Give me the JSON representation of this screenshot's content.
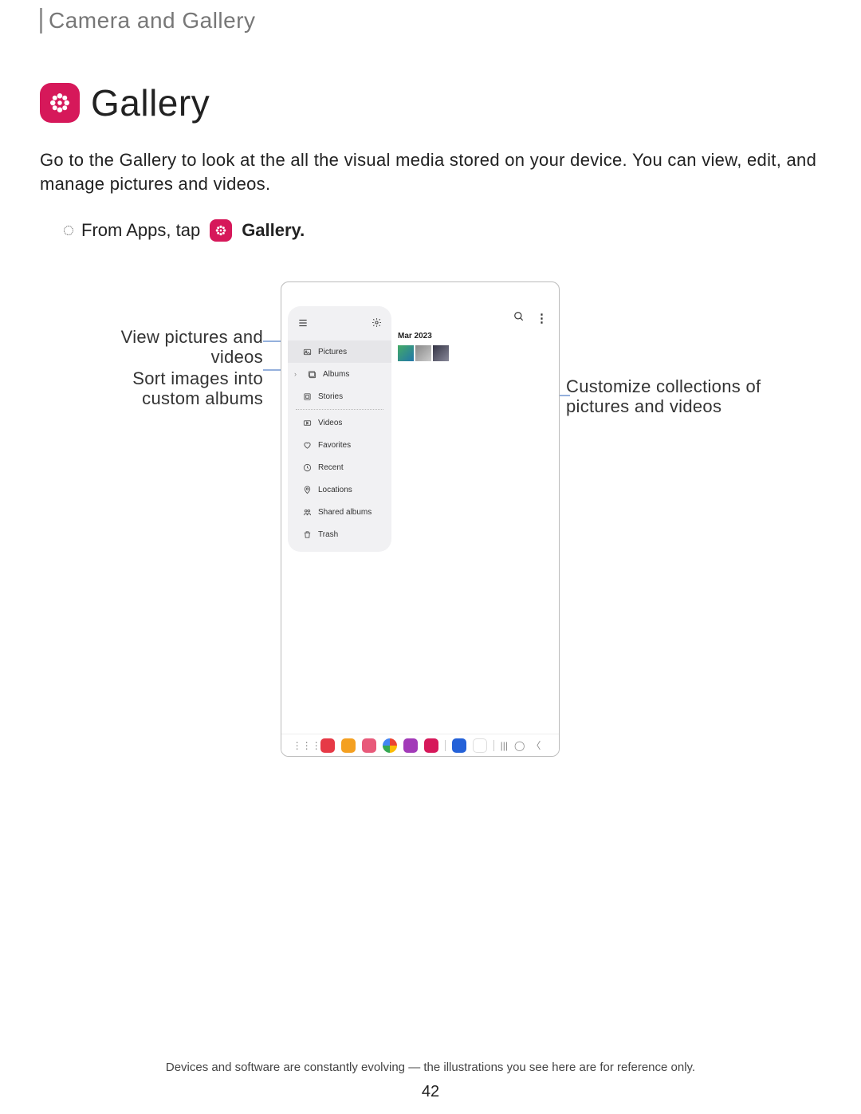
{
  "breadcrumb": "Camera and Gallery",
  "title": "Gallery",
  "intro": "Go to the Gallery to look at the all the visual media stored on your device. You can view, edit, and manage pictures and videos.",
  "instruction_prefix": "From Apps, tap",
  "instruction_app": "Gallery.",
  "callouts": {
    "view": "View pictures and videos",
    "sort": "Sort images into custom albums",
    "customize": "Customize collections of pictures and videos"
  },
  "sidebar": {
    "items": [
      {
        "label": "Pictures"
      },
      {
        "label": "Albums"
      },
      {
        "label": "Stories"
      },
      {
        "label": "Videos"
      },
      {
        "label": "Favorites"
      },
      {
        "label": "Recent"
      },
      {
        "label": "Locations"
      },
      {
        "label": "Shared albums"
      },
      {
        "label": "Trash"
      }
    ]
  },
  "content": {
    "date_group": "Mar 2023"
  },
  "footnote": "Devices and software are constantly evolving — the illustrations you see here are for reference only.",
  "page_number": "42"
}
